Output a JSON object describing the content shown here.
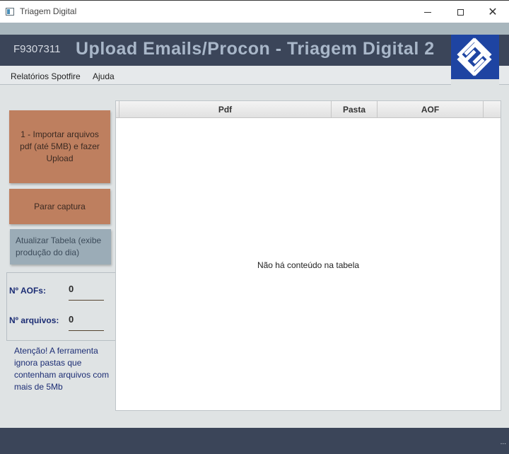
{
  "window": {
    "title": "Triagem Digital"
  },
  "header": {
    "user_code": "F9307311",
    "title": "Upload Emails/Procon - Triagem Digital 2"
  },
  "menu": {
    "items": [
      "Relatórios Spotfire",
      "Ajuda"
    ]
  },
  "buttons": {
    "import_label": "1 - Importar arquivos pdf (até 5MB) e fazer Upload",
    "stop_label": "Parar captura",
    "refresh_label": "Atualizar Tabela (exibe produção do dia)"
  },
  "counters": {
    "aofs_label": "Nº AOFs:",
    "aofs_value": "0",
    "files_label": "Nº arquivos:",
    "files_value": "0"
  },
  "warning": "Atenção! A ferramenta ignora pastas que contenham arquivos com mais de 5Mb",
  "table": {
    "columns": [
      "Pdf",
      "Pasta",
      "AOF"
    ],
    "rows": [],
    "empty_message": "Não há conteúdo na tabela"
  },
  "footer": {
    "overflow_label": "..."
  },
  "colors": {
    "header_bg": "#3b4559",
    "accent_button": "#be7f5f",
    "secondary_button": "#9bacb7",
    "logo_bg": "#1e44a2",
    "label_text": "#1c2d74"
  },
  "icons": {
    "app": "app-window-icon",
    "logo": "banco-do-brasil-logo"
  }
}
